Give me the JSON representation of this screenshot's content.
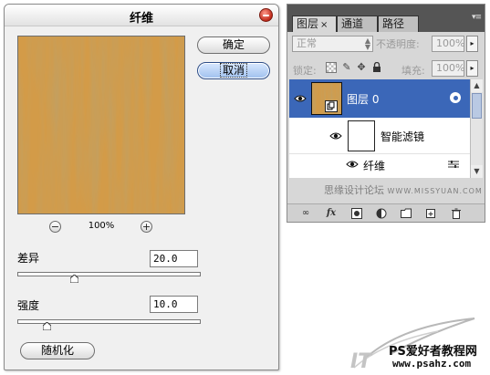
{
  "dialog": {
    "title": "纤维",
    "ok_label": "确定",
    "cancel_label": "取消",
    "zoom_level": "100%",
    "zoom_out_glyph": "−",
    "zoom_in_glyph": "+",
    "variance_label": "差异",
    "variance_value": "20.0",
    "variance_fraction": 0.3,
    "strength_label": "强度",
    "strength_value": "10.0",
    "strength_fraction": 0.14,
    "random_label": "随机化"
  },
  "layers_panel": {
    "tabs": [
      {
        "label": "图层",
        "active": true
      },
      {
        "label": "通道",
        "active": false
      },
      {
        "label": "路径",
        "active": false
      }
    ],
    "blend_mode": "正常",
    "opacity_label": "不透明度:",
    "opacity_value": "100%",
    "lock_label": "锁定:",
    "fill_label": "填充:",
    "fill_value": "100%",
    "layer_name": "图层 0",
    "smart_filter_label": "智能滤镜",
    "filter_name": "纤维",
    "watermark": "思缘设计论坛",
    "watermark_url": "WWW.MISSYUAN.COM",
    "footer_icons": [
      "link-icon",
      "fx-icon",
      "mask-icon",
      "adjustment-icon",
      "group-icon",
      "new-layer-icon",
      "trash-icon"
    ]
  },
  "logo": {
    "site_name": "PS爱好者教程网",
    "site_url": "www.psahz.com"
  },
  "colors": {
    "accent_selected": "#3b67b8",
    "wood_light": "#d49a45",
    "wood_dark": "#8a5a1e"
  }
}
